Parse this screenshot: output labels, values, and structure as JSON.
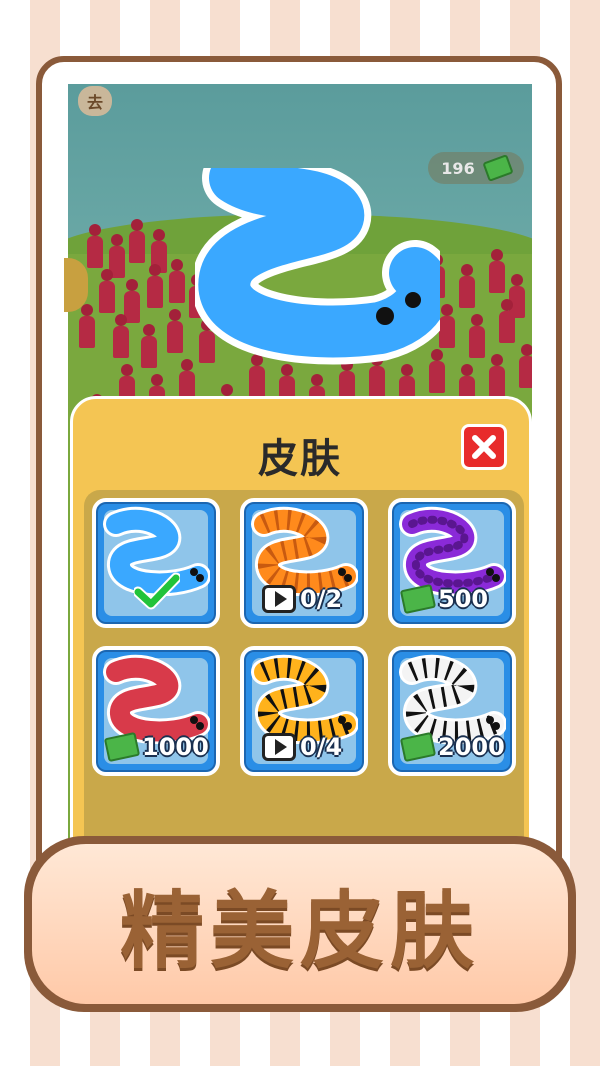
{
  "hud": {
    "pause_label": "去",
    "currency_amount": "196",
    "currency_icon": "cash-icon"
  },
  "skin_panel": {
    "title": "皮肤",
    "close_icon": "close-icon",
    "skins": [
      {
        "color": "#3aa8ff",
        "stripe": "none",
        "price_type": "owned",
        "price": ""
      },
      {
        "color": "#ff8a1c",
        "stripe": "stripes",
        "price_type": "ad",
        "price": "0/2"
      },
      {
        "color": "#8a2ad8",
        "stripe": "dots",
        "price_type": "cash",
        "price": "500"
      },
      {
        "color": "#d83a4a",
        "stripe": "none",
        "price_type": "cash",
        "price": "1000"
      },
      {
        "color": "#ffb21c",
        "stripe": "tiger",
        "price_type": "ad",
        "price": "0/4"
      },
      {
        "color": "#ffffff",
        "stripe": "zebra",
        "price_type": "cash",
        "price": "2000"
      }
    ]
  },
  "banner": {
    "text": "精美皮肤"
  },
  "colors": {
    "panel_bg": "#f4c553",
    "card_bg": "#2a8ee6",
    "close_bg": "#e82b2b",
    "banner_text": "#9a6235"
  }
}
